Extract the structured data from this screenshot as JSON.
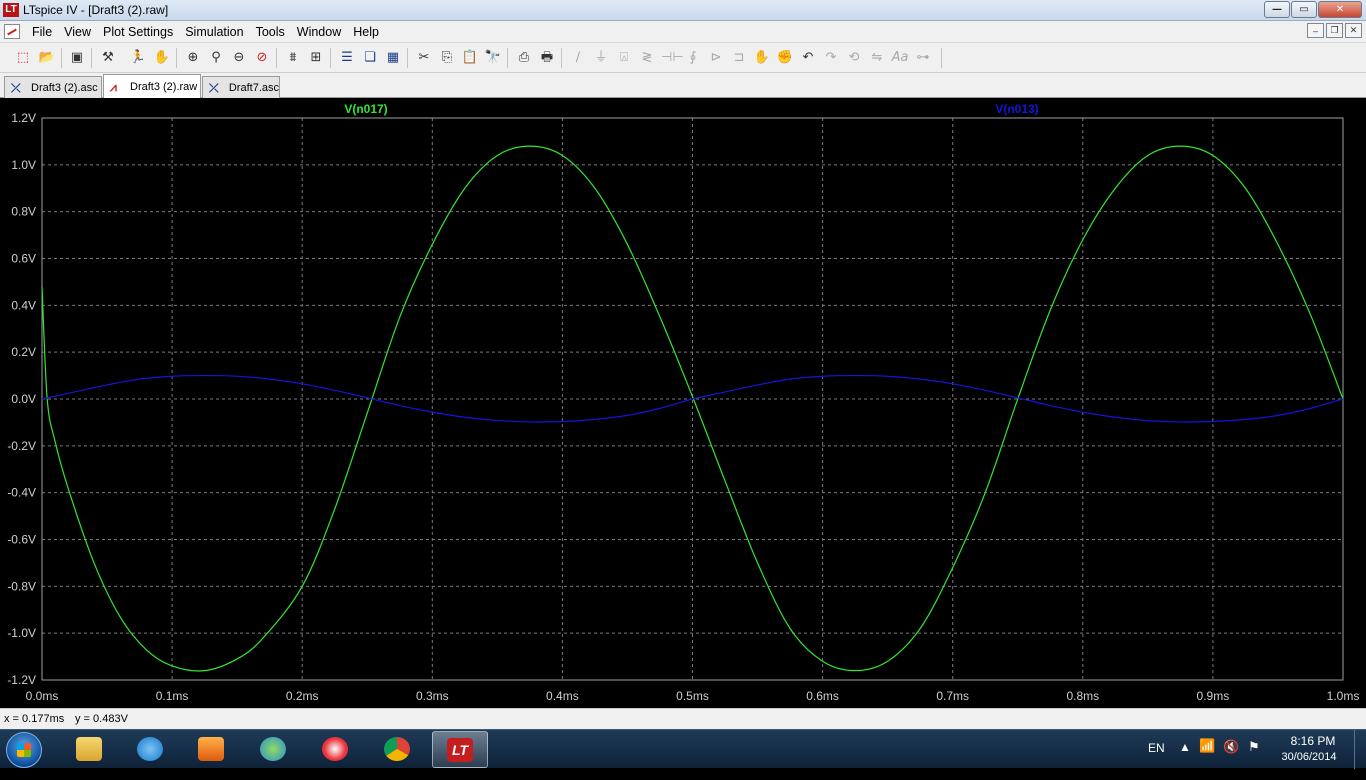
{
  "window": {
    "title": "LTspice IV - [Draft3 (2).raw]",
    "logo": "LT",
    "buttons": {
      "minimize": "—",
      "maximize": "▭",
      "close": "✕"
    }
  },
  "menu": {
    "items": [
      "File",
      "View",
      "Plot Settings",
      "Simulation",
      "Tools",
      "Window",
      "Help"
    ],
    "mdi": {
      "minimize": "–",
      "restore": "❐",
      "close": "✕"
    }
  },
  "toolbar": {
    "icons": [
      "new-schematic-icon",
      "open-icon",
      "save-icon",
      "control-panel-icon",
      "run-icon",
      "pan-hand-icon",
      "zoom-in-icon",
      "zoom-fit-icon",
      "zoom-out-icon",
      "zoom-cancel-icon",
      "autorange-icon",
      "grid-icon",
      "tile-horizontal-icon",
      "cascade-icon",
      "tile-icon",
      "cut-icon",
      "copy-icon",
      "paste-icon",
      "find-icon",
      "print-setup-icon",
      "print-icon",
      "wire-icon",
      "ground-icon",
      "label-net-icon",
      "resistor-icon",
      "capacitor-icon",
      "inductor-icon",
      "diode-icon",
      "component-icon",
      "move-icon",
      "drag-icon",
      "undo-icon",
      "redo-icon",
      "rotate-icon",
      "mirror-icon",
      "text-icon",
      "spice-directive-icon"
    ]
  },
  "tabs": [
    {
      "label": "Draft3 (2).asc",
      "icon": "schematic-icon",
      "active": false
    },
    {
      "label": "Draft3 (2).raw",
      "icon": "waveform-icon",
      "active": true
    },
    {
      "label": "Draft7.asc",
      "icon": "schematic-icon",
      "active": false
    }
  ],
  "chart_data": {
    "type": "line",
    "title": "",
    "xlabel": "",
    "ylabel": "",
    "xlim": [
      0,
      1.0
    ],
    "ylim": [
      -1.2,
      1.2
    ],
    "x_unit": "ms",
    "y_unit": "V",
    "x_ticks": [
      "0.0ms",
      "0.1ms",
      "0.2ms",
      "0.3ms",
      "0.4ms",
      "0.5ms",
      "0.6ms",
      "0.7ms",
      "0.8ms",
      "0.9ms",
      "1.0ms"
    ],
    "y_ticks": [
      "1.2V",
      "1.0V",
      "0.8V",
      "0.6V",
      "0.4V",
      "0.2V",
      "0.0V",
      "-0.2V",
      "-0.4V",
      "-0.6V",
      "-0.8V",
      "-1.0V",
      "-1.2V"
    ],
    "grid": true,
    "legend": "top",
    "background": "#000000",
    "series": [
      {
        "name": "V(n017)",
        "color": "#32e632",
        "x": [
          0,
          0.004,
          0.01,
          0.02,
          0.04,
          0.06,
          0.08,
          0.1,
          0.125,
          0.15,
          0.17,
          0.2,
          0.225,
          0.25,
          0.275,
          0.3,
          0.325,
          0.35,
          0.375,
          0.4,
          0.425,
          0.45,
          0.475,
          0.5,
          0.525,
          0.55,
          0.575,
          0.6,
          0.625,
          0.65,
          0.675,
          0.7,
          0.725,
          0.75,
          0.775,
          0.8,
          0.825,
          0.85,
          0.875,
          0.9,
          0.925,
          0.95,
          0.975,
          1.0
        ],
        "y": [
          0.48,
          0.0,
          -0.18,
          -0.38,
          -0.7,
          -0.93,
          -1.07,
          -1.14,
          -1.16,
          -1.11,
          -1.02,
          -0.8,
          -0.47,
          -0.06,
          0.35,
          0.66,
          0.9,
          1.04,
          1.08,
          1.04,
          0.9,
          0.66,
          0.35,
          0.01,
          -0.35,
          -0.7,
          -0.98,
          -1.12,
          -1.16,
          -1.12,
          -0.98,
          -0.72,
          -0.4,
          0.0,
          0.38,
          0.68,
          0.9,
          1.04,
          1.08,
          1.04,
          0.9,
          0.66,
          0.36,
          0.0
        ]
      },
      {
        "name": "V(n013)",
        "color": "#1414dc",
        "x": [
          0,
          0.025,
          0.05,
          0.075,
          0.1,
          0.125,
          0.15,
          0.175,
          0.2,
          0.225,
          0.25,
          0.275,
          0.3,
          0.325,
          0.35,
          0.375,
          0.4,
          0.425,
          0.45,
          0.475,
          0.5,
          0.525,
          0.55,
          0.575,
          0.6,
          0.625,
          0.65,
          0.675,
          0.7,
          0.725,
          0.75,
          0.775,
          0.8,
          0.825,
          0.85,
          0.875,
          0.9,
          0.925,
          0.95,
          0.975,
          1.0
        ],
        "y": [
          0.0,
          0.03,
          0.06,
          0.085,
          0.097,
          0.1,
          0.097,
          0.085,
          0.065,
          0.037,
          0.005,
          -0.028,
          -0.056,
          -0.078,
          -0.092,
          -0.098,
          -0.096,
          -0.087,
          -0.07,
          -0.04,
          0.0,
          0.03,
          0.06,
          0.085,
          0.097,
          0.1,
          0.097,
          0.085,
          0.065,
          0.037,
          0.005,
          -0.028,
          -0.056,
          -0.078,
          -0.092,
          -0.098,
          -0.096,
          -0.087,
          -0.07,
          -0.04,
          0.0
        ]
      }
    ]
  },
  "status": {
    "x_readout": "x = 0.177ms",
    "y_readout": "y = 0.483V"
  },
  "taskbar": {
    "apps": [
      "file-explorer-icon",
      "internet-explorer-icon",
      "media-player-icon",
      "messenger-icon",
      "picasa-icon",
      "chrome-icon",
      "ltspice-icon"
    ],
    "language": "EN",
    "time": "8:16 PM",
    "date": "30/06/2014"
  }
}
